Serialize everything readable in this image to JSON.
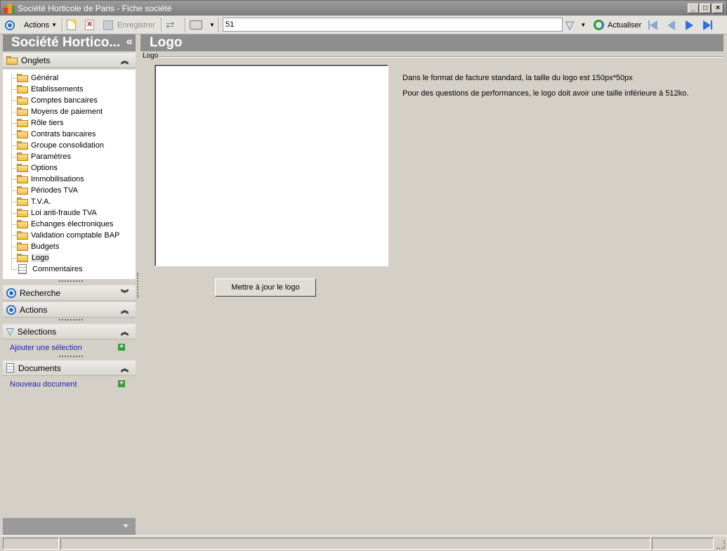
{
  "window": {
    "title": "Société Horticole de Paris - Fiche société",
    "controls": [
      "minimize",
      "maximize",
      "close"
    ]
  },
  "toolbar": {
    "actions_label": "Actions",
    "save_label": "Enregistrer",
    "search_value": "51",
    "refresh_label": "Actualiser"
  },
  "left_panel": {
    "title": "Société Hortico...",
    "collapse_glyph": "«",
    "onglets": {
      "label": "Onglets",
      "items": [
        {
          "label": "Général"
        },
        {
          "label": "Etablissements"
        },
        {
          "label": "Comptes bancaires"
        },
        {
          "label": "Moyens de paiement"
        },
        {
          "label": "Rôle tiers"
        },
        {
          "label": "Contrats bancaires"
        },
        {
          "label": "Groupe consolidation"
        },
        {
          "label": "Paramètres"
        },
        {
          "label": "Options"
        },
        {
          "label": "Immobilisations"
        },
        {
          "label": "Périodes TVA"
        },
        {
          "label": "T.V.A."
        },
        {
          "label": "Loi anti-fraude TVA"
        },
        {
          "label": "Echanges électroniques"
        },
        {
          "label": "Validation comptable BAP"
        },
        {
          "label": "Budgets"
        },
        {
          "label": "Logo",
          "selected": true
        },
        {
          "label": "Commentaires",
          "icon": "document-icon"
        }
      ]
    },
    "recherche_label": "Recherche",
    "actions_label": "Actions",
    "selections": {
      "label": "Sélections",
      "link": "Ajouter une sélection"
    },
    "documents": {
      "label": "Documents",
      "link": "Nouveau document"
    }
  },
  "main": {
    "header": "Logo",
    "group_label": "Logo",
    "button_label": "Mettre à jour le logo",
    "info_line1": "Dans le format de facture standard, la taille du logo est 150px*50px",
    "info_line2": "Pour des questions de performances, le logo doit avoir une taille inférieure à 512ko."
  },
  "colors": {
    "header_bg": "#8e8e8e",
    "link": "#2020c0",
    "accent_blue": "#2f6fbf",
    "window_bg": "#d4d0c8"
  }
}
